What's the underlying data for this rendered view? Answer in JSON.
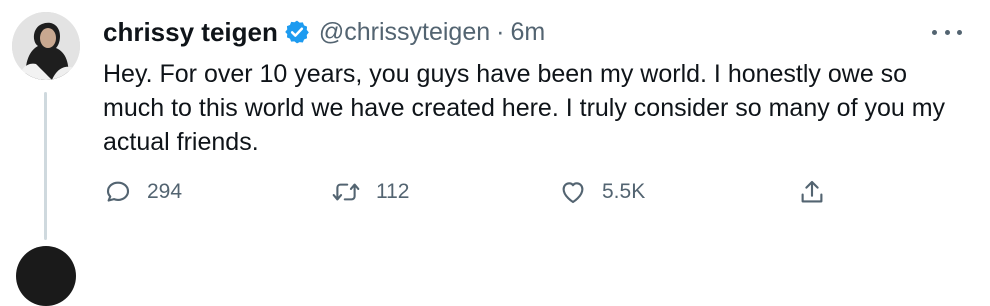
{
  "tweet": {
    "author": {
      "display_name": "chrissy teigen",
      "handle": "@chrissyteigen",
      "verified": true
    },
    "separator": "·",
    "timestamp": "6m",
    "text": "Hey. For over 10 years, you guys have been my world. I honestly owe so much to this world we have created here. I truly consider so many of you my actual friends.",
    "stats": {
      "replies": "294",
      "retweets": "112",
      "likes": "5.5K"
    }
  },
  "icons": {
    "verified": "verified-badge-icon",
    "more": "more-icon",
    "reply": "reply-icon",
    "retweet": "retweet-icon",
    "like": "heart-icon",
    "share": "share-icon"
  },
  "colors": {
    "text": "#0f1419",
    "secondary": "#536471",
    "verified": "#1d9bf0",
    "thread_line": "#cfd9de"
  }
}
